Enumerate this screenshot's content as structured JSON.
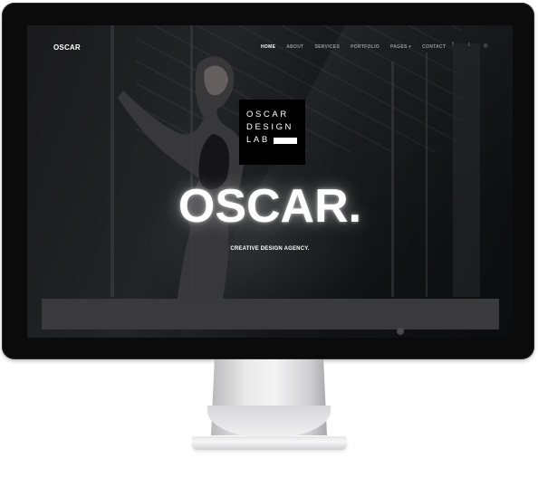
{
  "nav": {
    "logo": "OSCAR",
    "items": [
      {
        "label": "HOME",
        "active": true
      },
      {
        "label": "ABOUT",
        "active": false
      },
      {
        "label": "SERVICES",
        "active": false
      },
      {
        "label": "PORTFOLIO",
        "active": false
      },
      {
        "label": "PAGES ▾",
        "active": false
      },
      {
        "label": "CONTACT",
        "active": false
      }
    ],
    "social": [
      {
        "icon": "facebook-icon",
        "glyph": "f"
      },
      {
        "icon": "twitter-icon",
        "glyph": "t"
      },
      {
        "icon": "globe-icon",
        "glyph": "◎"
      }
    ]
  },
  "badge": {
    "line1": "OSCAR",
    "line2": "DESIGN",
    "line3": "LAB"
  },
  "hero": {
    "title": "OSCAR.",
    "subtitle": "CREATIVE DESIGN AGENCY."
  },
  "colors": {
    "bezel": "#0b0b0b",
    "text": "#ffffff",
    "nav_inactive": "#9a9a9a",
    "band": "#3a3a3c"
  }
}
